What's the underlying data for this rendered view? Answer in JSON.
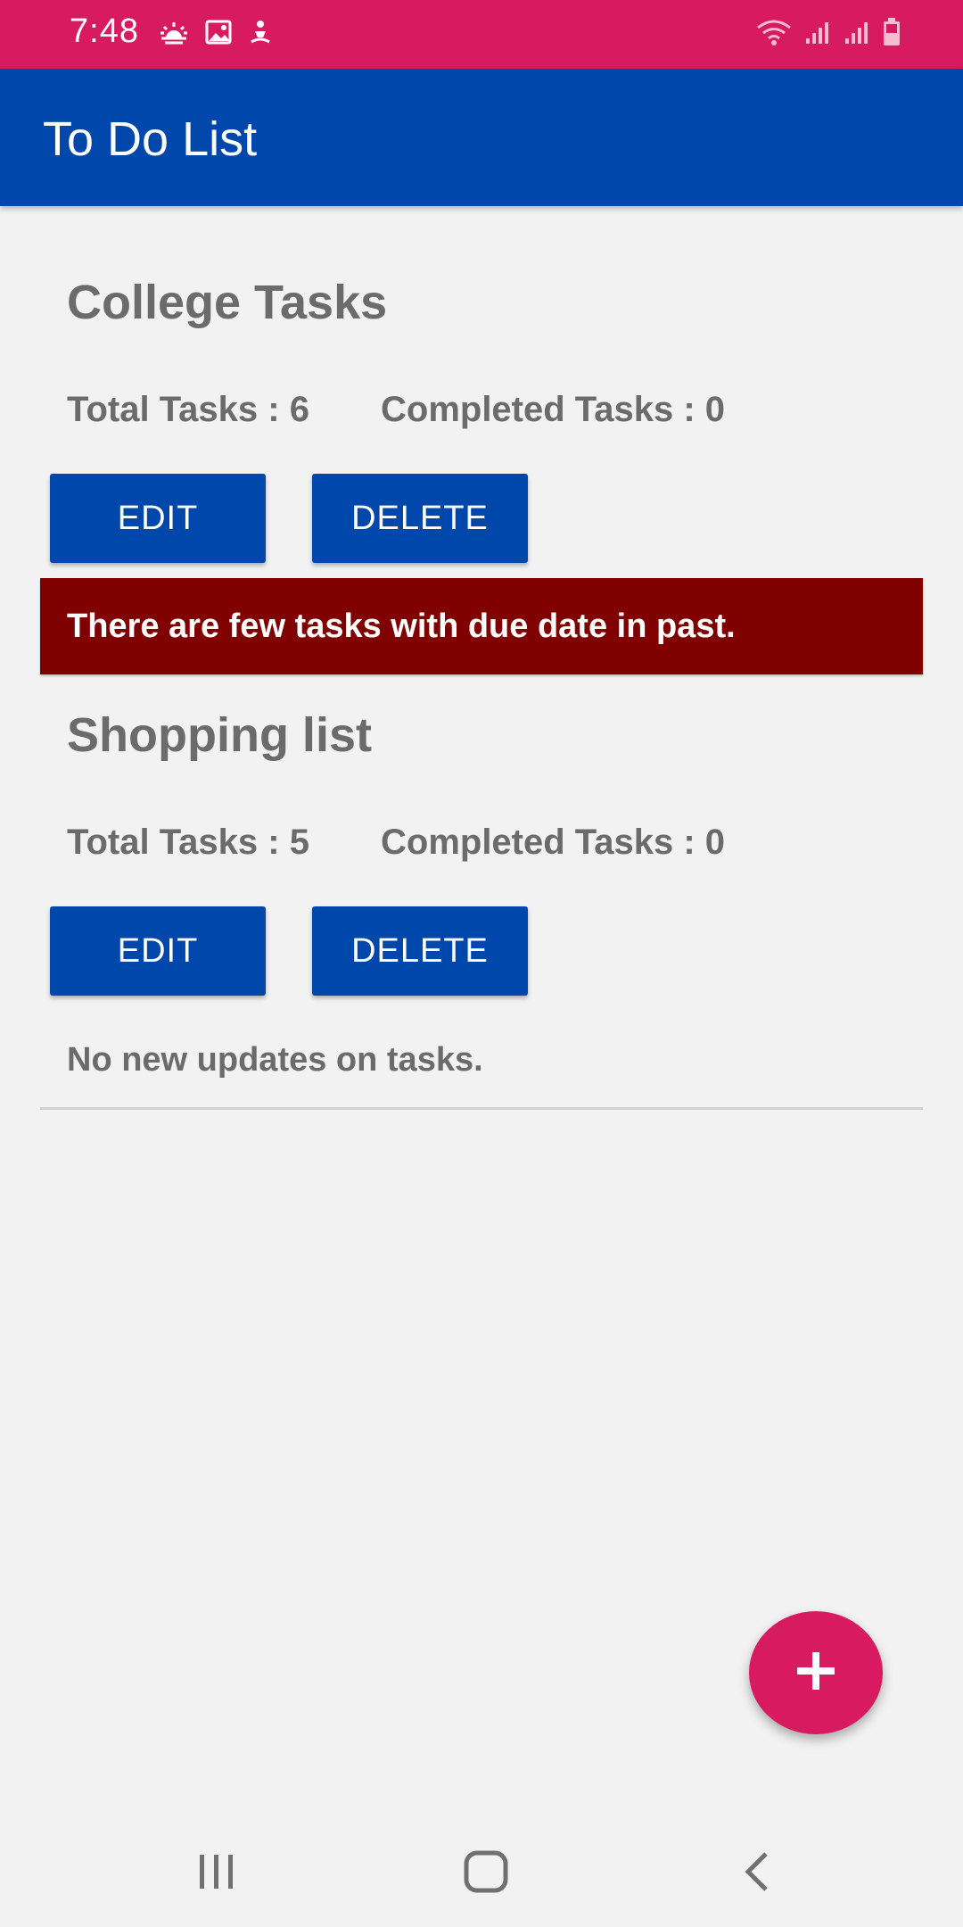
{
  "status_bar": {
    "time": "7:48",
    "left_icons": [
      "weather-icon",
      "image-icon",
      "accessibility-icon"
    ],
    "right_icons": [
      "wifi-icon",
      "signal-icon",
      "signal-icon",
      "battery-icon"
    ],
    "color": "#d81b60"
  },
  "app_bar": {
    "title": "To Do List",
    "color": "#0047ab"
  },
  "lists": [
    {
      "title": "College Tasks",
      "total_label": "Total Tasks : 6",
      "completed_label": "Completed Tasks : 0",
      "edit_label": "EDIT",
      "delete_label": "DELETE",
      "warning": "There are few tasks with due date in past."
    },
    {
      "title": "Shopping list",
      "total_label": "Total Tasks : 5",
      "completed_label": "Completed Tasks : 0",
      "edit_label": "EDIT",
      "delete_label": "DELETE",
      "info": "No new updates on tasks."
    }
  ],
  "fab": {
    "icon": "plus-icon",
    "color": "#d81b60"
  },
  "nav_bar": {
    "icons": [
      "recent-apps-icon",
      "home-icon",
      "back-icon"
    ]
  },
  "colors": {
    "warning": "#800000",
    "button": "#0047ab",
    "text_gray": "#6b6b6b",
    "background": "#f2f2f2"
  }
}
